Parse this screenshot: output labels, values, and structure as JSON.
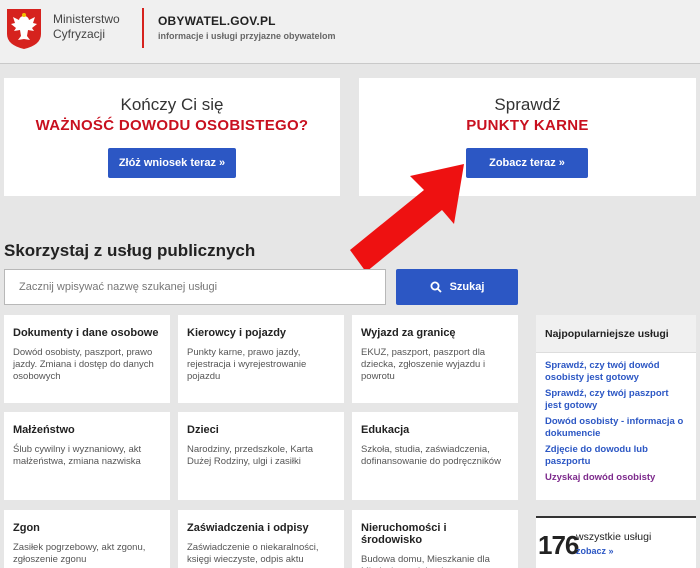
{
  "header": {
    "ministry_line1": "Ministerstwo",
    "ministry_line2": "Cyfryzacji",
    "site_title": "OBYWATEL.GOV.PL",
    "site_subtitle": "informacje i usługi przyjazne obywatelom"
  },
  "promos": [
    {
      "line1": "Kończy Ci się",
      "line2": "WAŻNOŚĆ DOWODU OSOBISTEGO?",
      "button": "Złóż wniosek teraz »"
    },
    {
      "line1": "Sprawdź",
      "line2": "PUNKTY KARNE",
      "button": "Zobacz teraz »"
    }
  ],
  "search": {
    "section_title": "Skorzystaj z usług publicznych",
    "placeholder": "Zacznij wpisywać nazwę szukanej usługi",
    "button": "Szukaj"
  },
  "tiles": [
    {
      "title": "Dokumenty i dane osobowe",
      "desc": "Dowód osobisty, paszport, prawo jazdy. Zmiana i dostęp do danych osobowych"
    },
    {
      "title": "Kierowcy i pojazdy",
      "desc": "Punkty karne, prawo jazdy, rejestracja i wyrejestrowanie pojazdu"
    },
    {
      "title": "Wyjazd za granicę",
      "desc": "EKUZ, paszport, paszport dla dziecka, zgłoszenie wyjazdu i powrotu"
    },
    {
      "title": "Małżeństwo",
      "desc": "Ślub cywilny i wyznaniowy, akt małżeństwa, zmiana nazwiska"
    },
    {
      "title": "Dzieci",
      "desc": "Narodziny, przedszkole, Karta Dużej Rodziny, ulgi i zasiłki"
    },
    {
      "title": "Edukacja",
      "desc": "Szkoła, studia, zaświadczenia, dofinansowanie do podręczników"
    },
    {
      "title": "Zgon",
      "desc": "Zasiłek pogrzebowy, akt zgonu, zgłoszenie zgonu"
    },
    {
      "title": "Zaświadczenia i odpisy",
      "desc": "Zaświadczenie o niekaralności, księgi wieczyste, odpis aktu"
    },
    {
      "title": "Nieruchomości i środowisko",
      "desc": "Budowa domu, Mieszkanie dla Młodych, wycinka drzew, prace"
    }
  ],
  "popular": {
    "title": "Najpopularniejsze usługi",
    "links": [
      "Sprawdź, czy twój dowód osobisty jest gotowy",
      "Sprawdź, czy twój paszport jest gotowy",
      "Dowód osobisty - informacja o dokumencie",
      "Zdjęcie do dowodu lub paszportu",
      "Uzyskaj dowód osobisty"
    ]
  },
  "all_services": {
    "count": "176",
    "label": "wszystkie usługi",
    "link": "zobacz »"
  },
  "colors": {
    "brand_red": "#c8101f",
    "button_blue": "#2c57c4",
    "link_visited": "#7d2a8c"
  }
}
